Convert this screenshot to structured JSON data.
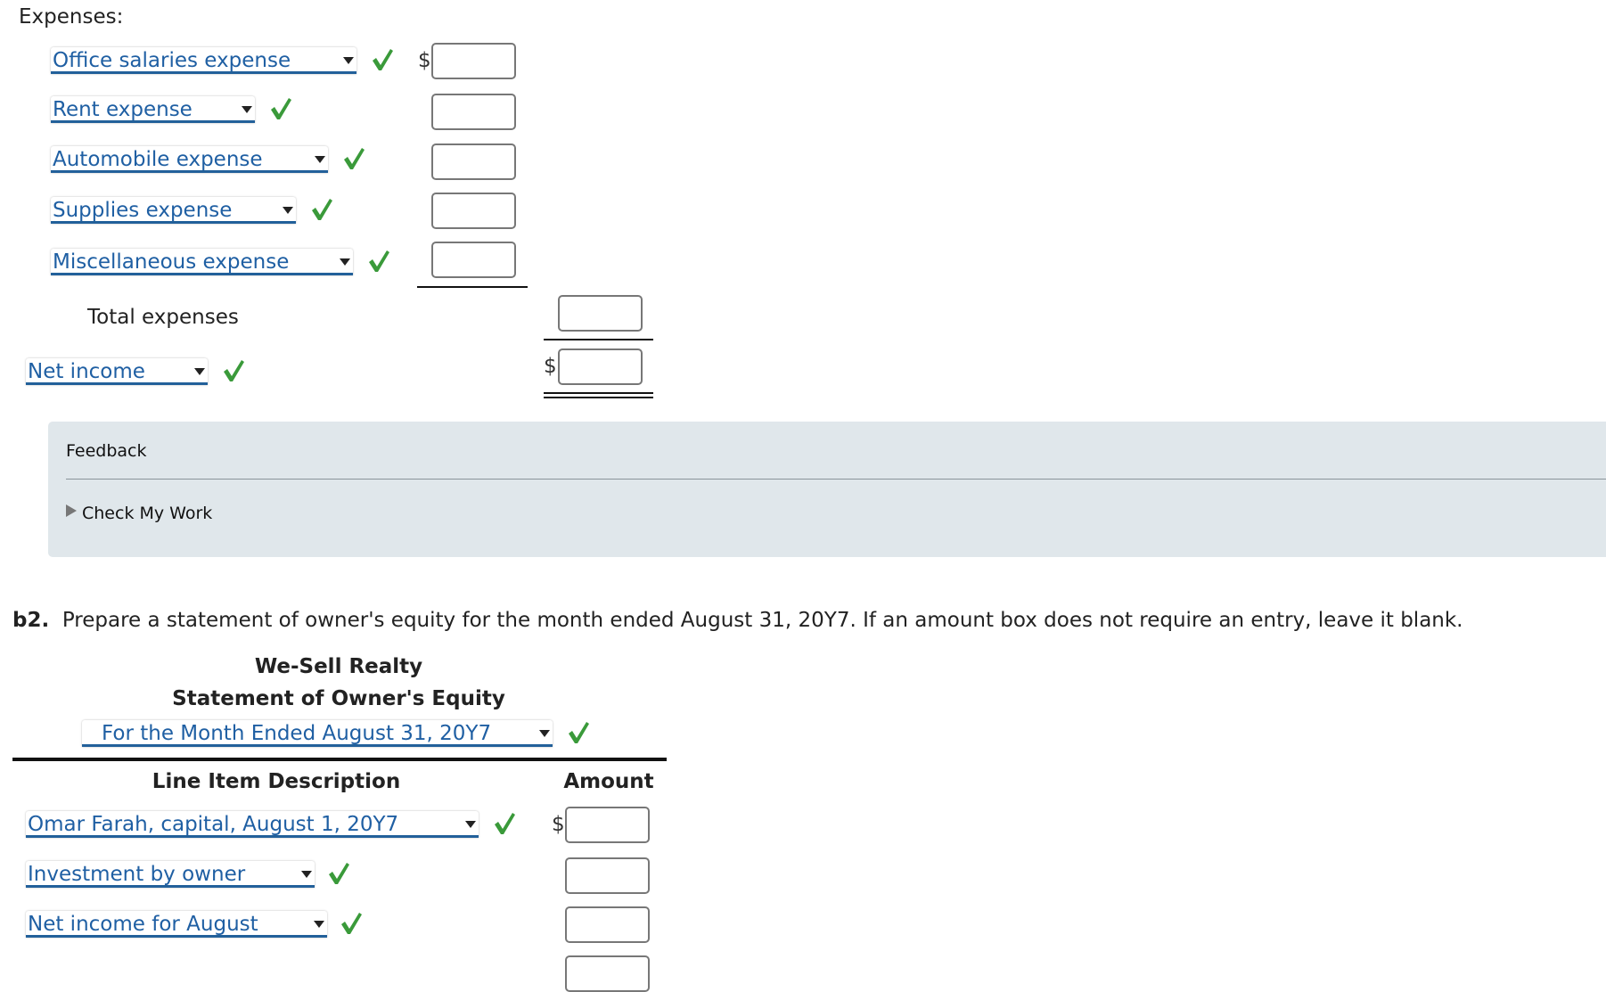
{
  "expenses_label": "Expenses:",
  "expense_rows": [
    {
      "label": "Office salaries expense",
      "dollar": "$"
    },
    {
      "label": "Rent expense"
    },
    {
      "label": "Automobile expense"
    },
    {
      "label": "Supplies expense"
    },
    {
      "label": "Miscellaneous expense"
    }
  ],
  "total_expenses_label": "Total expenses",
  "net_income": {
    "label": "Net income",
    "dollar": "$"
  },
  "feedback": {
    "title": "Feedback",
    "check_my_work": "Check My Work",
    "bg_color": "#e0e7eb"
  },
  "b2": {
    "number": "b2.",
    "instruction": "Prepare a statement of owner's equity for the month ended August 31, 20Y7. If an amount box does not require an entry, leave it blank.",
    "company": "We-Sell Realty",
    "statement_title": "Statement of Owner's Equity",
    "period": "For the Month Ended August 31, 20Y7",
    "col_description": "Line Item Description",
    "col_amount": "Amount",
    "rows": [
      {
        "label": "Omar Farah, capital, August 1, 20Y7",
        "dollar": "$"
      },
      {
        "label": "Investment by owner"
      },
      {
        "label": "Net income for August"
      }
    ]
  },
  "colors": {
    "link": "#1f5fa3",
    "check": "#3a9a3a"
  }
}
